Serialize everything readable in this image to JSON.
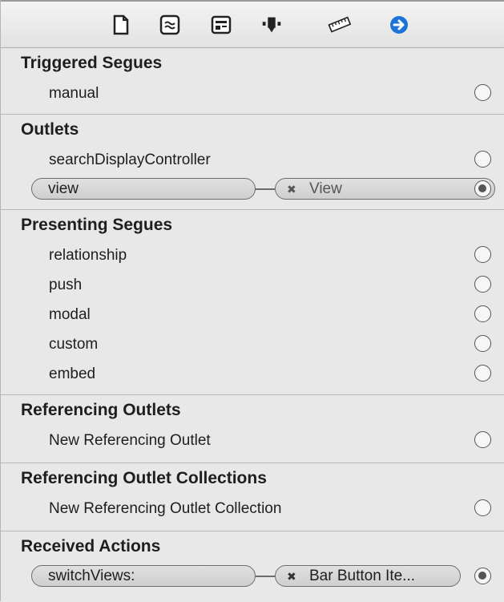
{
  "toolbar": {
    "icons": [
      {
        "name": "file-inspector-icon"
      },
      {
        "name": "quick-help-icon"
      },
      {
        "name": "identity-inspector-icon"
      },
      {
        "name": "attributes-inspector-icon"
      },
      {
        "name": "size-inspector-icon"
      },
      {
        "name": "connections-inspector-icon",
        "color": "#1e73d8"
      }
    ]
  },
  "sections": {
    "triggered_segues": {
      "title": "Triggered Segues",
      "rows": [
        "manual"
      ]
    },
    "outlets": {
      "title": "Outlets",
      "rows": [
        "searchDisplayController"
      ],
      "connection": {
        "source": "view",
        "target": "View"
      }
    },
    "presenting_segues": {
      "title": "Presenting Segues",
      "rows": [
        "relationship",
        "push",
        "modal",
        "custom",
        "embed"
      ]
    },
    "referencing_outlets": {
      "title": "Referencing Outlets",
      "rows": [
        "New Referencing Outlet"
      ]
    },
    "referencing_outlet_collections": {
      "title": "Referencing Outlet Collections",
      "rows": [
        "New Referencing Outlet Collection"
      ]
    },
    "received_actions": {
      "title": "Received Actions",
      "connection": {
        "source": "switchViews:",
        "target": "Bar Button Ite..."
      }
    }
  },
  "colors": {
    "accent": "#1e73d8",
    "panel_bg": "#e8e8e8"
  }
}
